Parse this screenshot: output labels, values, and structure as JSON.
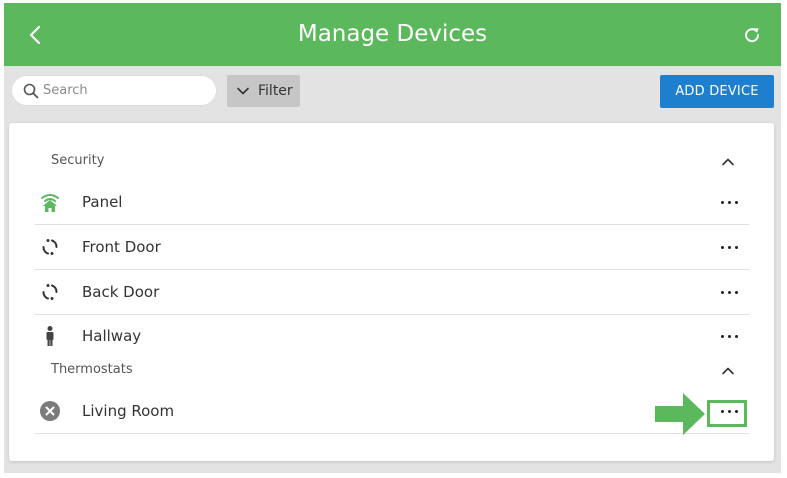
{
  "header": {
    "title": "Manage Devices",
    "back_icon": "chevron-left-icon",
    "refresh_icon": "refresh-icon"
  },
  "toolbar": {
    "search": {
      "placeholder": "Search",
      "value": "",
      "icon": "search-icon"
    },
    "filter_label": "Filter",
    "add_device_label": "ADD DEVICE"
  },
  "sections": [
    {
      "label": "Security",
      "devices": [
        {
          "label": "Panel",
          "icon": "panel-home-icon"
        },
        {
          "label": "Front Door",
          "icon": "door-sensor-icon"
        },
        {
          "label": "Back Door",
          "icon": "door-sensor-icon"
        },
        {
          "label": "Hallway",
          "icon": "motion-sensor-icon"
        }
      ]
    },
    {
      "label": "Thermostats",
      "devices": [
        {
          "label": "Living Room",
          "icon": "offline-x-icon"
        }
      ]
    }
  ],
  "colors": {
    "header_green": "#5cb85c",
    "add_button_blue": "#1e7fcf",
    "annotation_green": "#5cb85c"
  }
}
